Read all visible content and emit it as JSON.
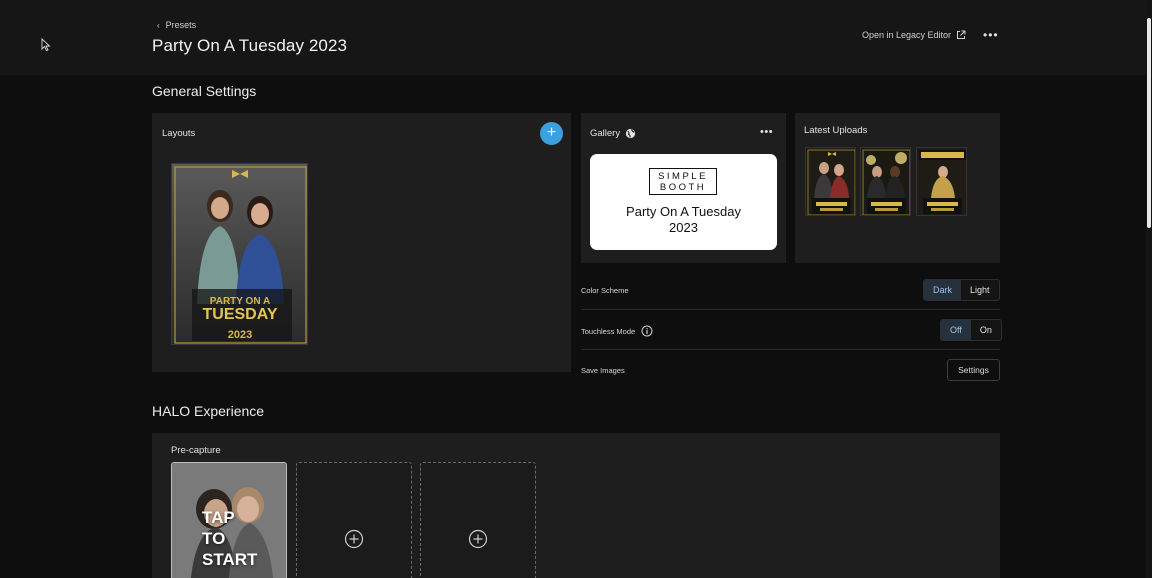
{
  "header": {
    "breadcrumb": "Presets",
    "title": "Party On A Tuesday 2023",
    "legacy_editor_label": "Open in Legacy Editor",
    "more_label": "•••"
  },
  "general_settings": {
    "title": "General Settings",
    "layouts": {
      "label": "Layouts",
      "add_label": "+",
      "thumbnail": {
        "headline_1": "PARTY ON A",
        "headline_2": "TUESDAY",
        "year": "2023"
      }
    },
    "gallery": {
      "label": "Gallery",
      "more_label": "•••",
      "logo_line_1": "SIMPLE",
      "logo_line_2": "BOOTH",
      "name_line_1": "Party On A Tuesday",
      "name_line_2": "2023"
    },
    "latest_uploads": {
      "label": "Latest Uploads"
    },
    "color_scheme": {
      "label": "Color Scheme",
      "options": [
        "Dark",
        "Light"
      ],
      "selected": "Dark"
    },
    "touchless_mode": {
      "label": "Touchless Mode",
      "options": [
        "Off",
        "On"
      ],
      "selected": "Off"
    },
    "save_images": {
      "label": "Save Images",
      "button_label": "Settings"
    }
  },
  "halo_experience": {
    "title": "HALO Experience",
    "precapture": {
      "label": "Pre-capture",
      "slot_text": "TAP\nTO\nSTART"
    }
  },
  "colors": {
    "accent": "#3aa0de",
    "background": "#0e0e0e",
    "panel": "#1e1e1e",
    "gold": "#d9b84a"
  }
}
